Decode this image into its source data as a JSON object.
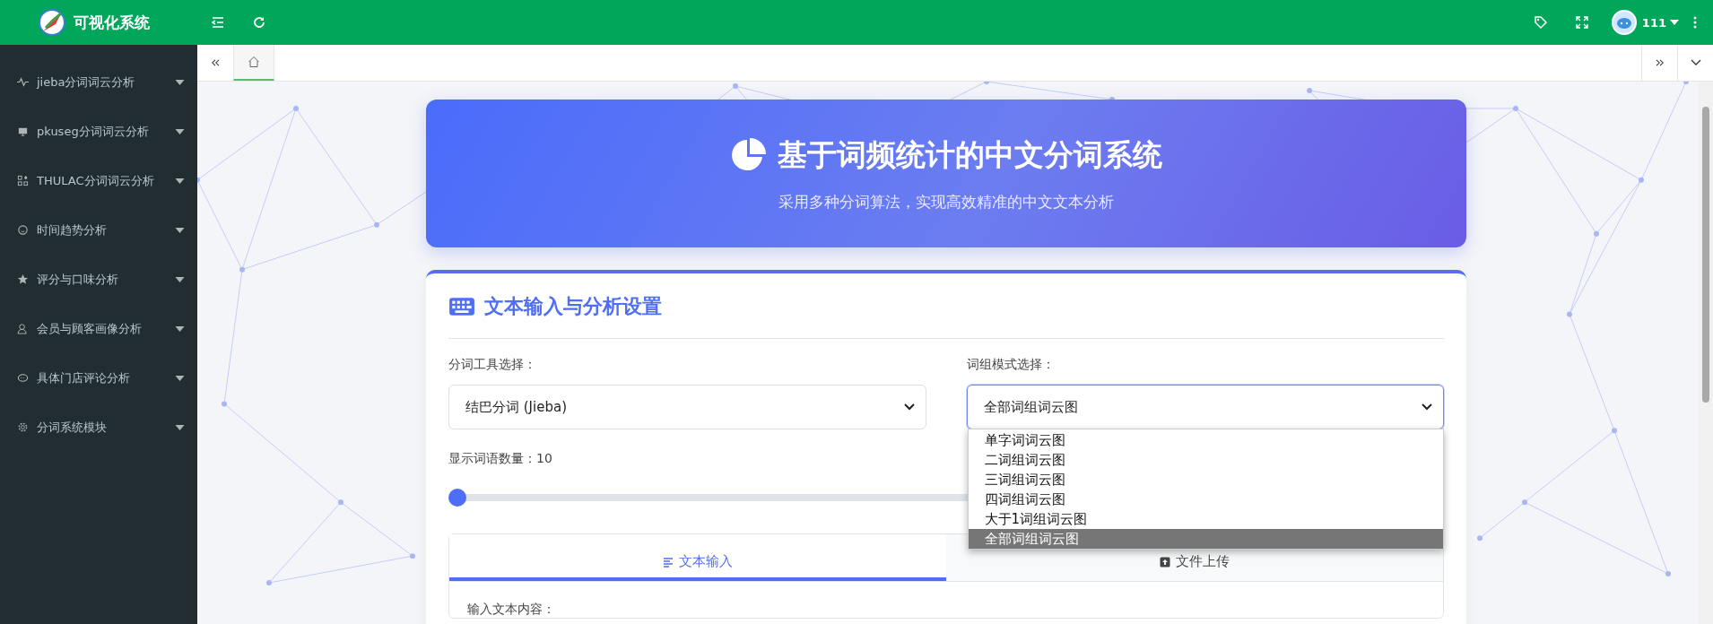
{
  "app": {
    "title": "可视化系统"
  },
  "user": {
    "name": "111"
  },
  "sidebar": {
    "items": [
      {
        "label": "jieba分词词云分析",
        "expanded": false
      },
      {
        "label": "pkuseg分词词云分析",
        "expanded": false
      },
      {
        "label": "THULAC分词词云分析",
        "expanded": false
      },
      {
        "label": "时间趋势分析",
        "expanded": false
      },
      {
        "label": "评分与口味分析",
        "expanded": false
      },
      {
        "label": "会员与顾客画像分析",
        "expanded": false
      },
      {
        "label": "具体门店评论分析",
        "expanded": false
      },
      {
        "label": "分词系统模块",
        "expanded": false
      }
    ]
  },
  "page_tabs": [
    {
      "kind": "home",
      "selected": true
    }
  ],
  "banner": {
    "title": "基于词频统计的中文分词系统",
    "subtitle": "采用多种分词算法，实现高效精准的中文文本分析"
  },
  "panel": {
    "title": "文本输入与分析设置",
    "tool": {
      "label": "分词工具选择：",
      "value": "结巴分词 (Jieba)"
    },
    "mode": {
      "label": "词组模式选择：",
      "value": "全部词组词云图",
      "expanded": true,
      "options": [
        {
          "label": "单字词词云图",
          "selected": false
        },
        {
          "label": "二词组词云图",
          "selected": false
        },
        {
          "label": "三词组词云图",
          "selected": false
        },
        {
          "label": "四词组词云图",
          "selected": false
        },
        {
          "label": "大于1词组词云图",
          "selected": false
        },
        {
          "label": "全部词组词云图",
          "selected": true
        }
      ]
    },
    "count": {
      "label": "显示词语数量：10",
      "level": 0
    },
    "tabs": [
      {
        "label": "文本输入",
        "selected": true
      },
      {
        "label": "文件上传",
        "selected": false
      }
    ],
    "input_label": "输入文本内容："
  }
}
